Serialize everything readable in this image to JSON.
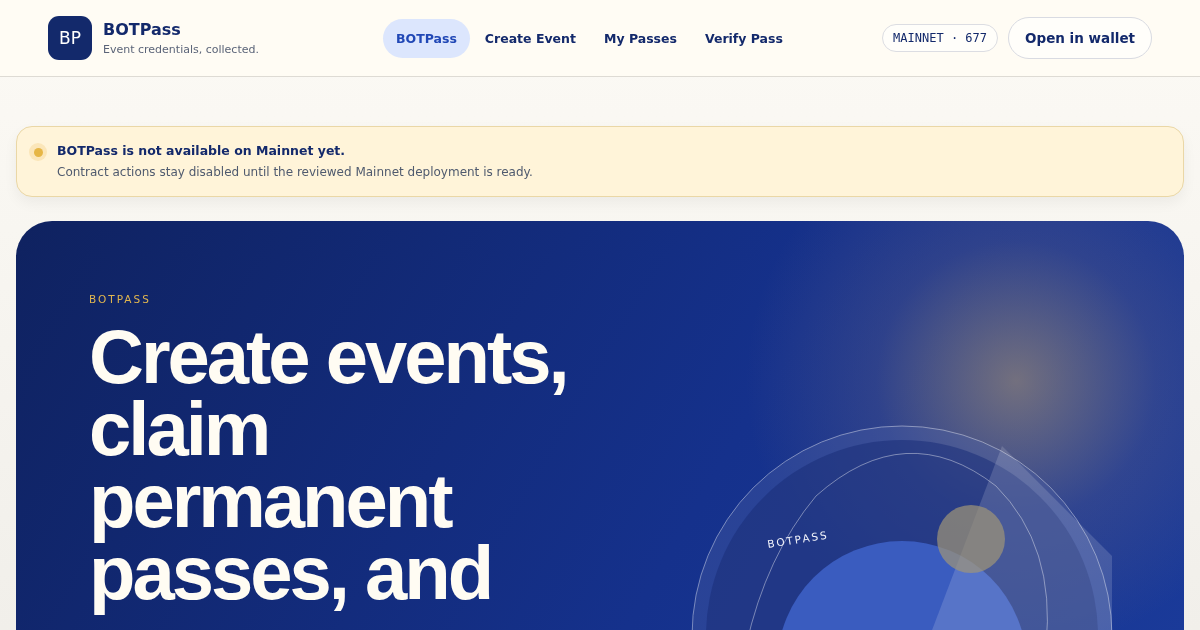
{
  "brand": {
    "logo": "BP",
    "name": "BOTPass",
    "tagline": "Event credentials, collected."
  },
  "nav": [
    {
      "label": "BOTPass",
      "selected": true
    },
    {
      "label": "Create Event",
      "selected": false
    },
    {
      "label": "My Passes",
      "selected": false
    },
    {
      "label": "Verify Pass",
      "selected": false
    }
  ],
  "network_badge": "MAINNET · 677",
  "wallet_button": "Open in wallet",
  "notice": {
    "title": "BOTPass is not available on Mainnet yet.",
    "message": "Contract actions stay disabled until the reviewed Mainnet deployment is ready."
  },
  "hero": {
    "eyebrow": "BOTPASS",
    "headline": "Create events, claim permanent passes, and",
    "coin_label": "BOTPASS"
  }
}
